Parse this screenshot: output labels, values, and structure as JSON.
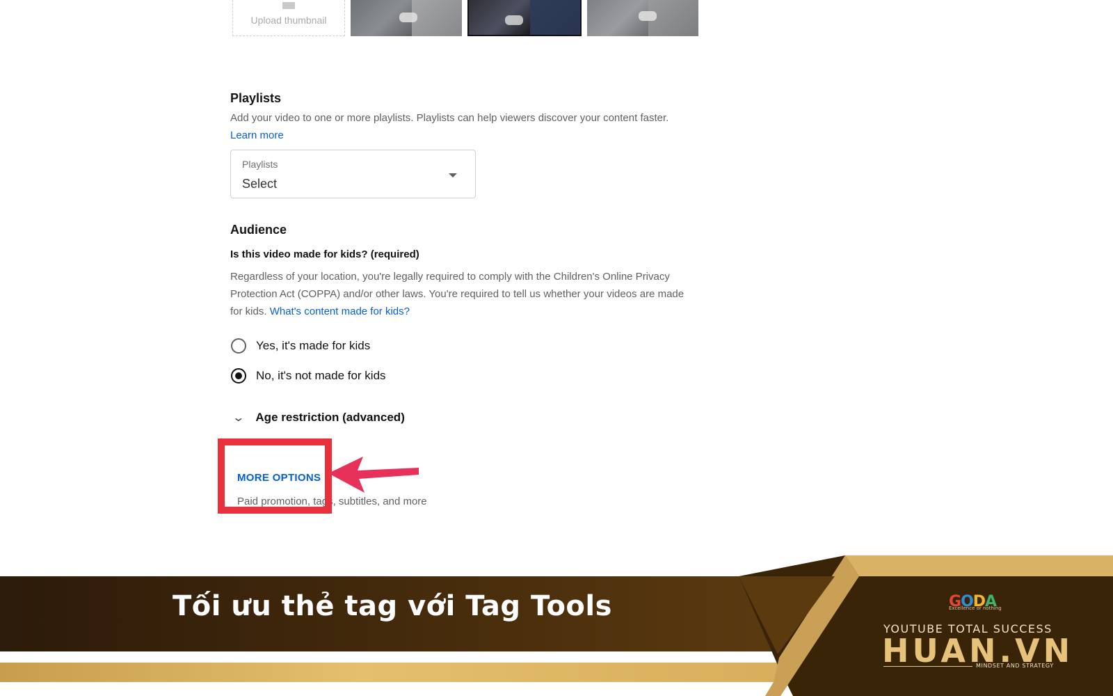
{
  "thumbnails": {
    "upload_label": "Upload thumbnail"
  },
  "playlists": {
    "heading": "Playlists",
    "description": "Add your video to one or more playlists. Playlists can help viewers discover your content faster.",
    "learn_more": "Learn more",
    "select_caption": "Playlists",
    "select_value": "Select"
  },
  "audience": {
    "heading": "Audience",
    "question": "Is this video made for kids? (required)",
    "description": "Regardless of your location, you're legally required to comply with the Children's Online Privacy Protection Act (COPPA) and/or other laws. You're required to tell us whether your videos are made for kids.",
    "link": "What's content made for kids?",
    "options": [
      {
        "label": "Yes, it's made for kids",
        "selected": false
      },
      {
        "label": "No, it's not made for kids",
        "selected": true
      }
    ],
    "age_restriction": "Age restriction (advanced)"
  },
  "more_options": {
    "button": "MORE OPTIONS",
    "subtitle": "Paid promotion, tags, subtitles, and more"
  },
  "banner": {
    "title": "Tối ưu thẻ tag với Tag Tools",
    "logo_letters": [
      "G",
      "O",
      "D",
      "A"
    ],
    "logo_tagline": "Excellence or nothing",
    "brand_line": "YOUTUBE TOTAL SUCCESS",
    "brand_name": "HUAN.VN",
    "brand_tagline": "MINDSET AND STRATEGY"
  },
  "colors": {
    "link": "#065fd4",
    "highlight": "#e8313d",
    "arrow": "#e8315a",
    "gold": "#e6c27a"
  }
}
